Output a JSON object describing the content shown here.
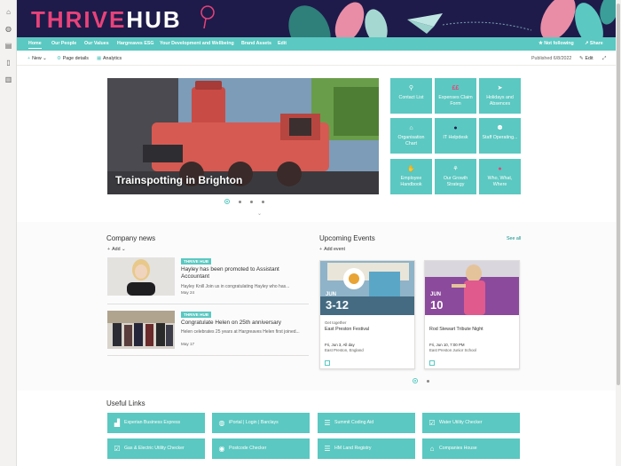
{
  "banner": {
    "logo_thrive": "THRIVE",
    "logo_hub": "HUB"
  },
  "nav": {
    "items": [
      "Home",
      "Our People",
      "Our Values",
      "Hargreaves ESG",
      "Your Development and Wellbeing",
      "Brand Assets",
      "Edit"
    ],
    "follow": "Not following",
    "share": "Share"
  },
  "commands": {
    "new": "New",
    "page_details": "Page details",
    "analytics": "Analytics",
    "published": "Published 6/8/2022",
    "edit": "Edit"
  },
  "hero": {
    "title": "Trainspotting in Brighton"
  },
  "tiles": [
    {
      "label": "Contact List",
      "icon": "search-icon"
    },
    {
      "label": "Expenses Claim Form",
      "icon": "money-icon"
    },
    {
      "label": "Holidays and Absences",
      "icon": "plane-icon"
    },
    {
      "label": "Organisation Chart",
      "icon": "org-chart-icon"
    },
    {
      "label": "IT Helpdesk",
      "icon": "headset-icon"
    },
    {
      "label": "Staff Operating...",
      "icon": "people-icon"
    },
    {
      "label": "Employee Handbook",
      "icon": "hand-icon"
    },
    {
      "label": "Our Growth Strategy",
      "icon": "growth-icon"
    },
    {
      "label": "Who, What, Where",
      "icon": "location-icon"
    }
  ],
  "news": {
    "title": "Company news",
    "add": "Add",
    "items": [
      {
        "tag": "THRIVE HUB",
        "title": "Hayley has been promoted to Assistant Accountant",
        "excerpt": "Hayley Knill Join us in congratulating Hayley who has...",
        "date": "May 24"
      },
      {
        "tag": "THRIVE HUB",
        "title": "Congratulate Helen on 25th anniversary",
        "excerpt": "Helen celebrates 25 years at Hargreaves Helen first joined...",
        "date": "May 17"
      }
    ]
  },
  "events": {
    "title": "Upcoming Events",
    "add": "Add event",
    "see_all": "See all",
    "items": [
      {
        "month": "JUN",
        "day": "3-12",
        "category": "Get together",
        "title": "East Preston Festival",
        "date": "Fri, Jun 3, All day",
        "location": "East Preston, England"
      },
      {
        "month": "JUN",
        "day": "10",
        "category": "",
        "title": "Rod Stewart Tribute Night",
        "date": "Fri, Jun 10, 7:00 PM",
        "location": "East Preston Junior School"
      }
    ]
  },
  "useful_links": {
    "title": "Useful Links",
    "items": [
      {
        "label": "Experian Business Express",
        "icon": "chart-icon"
      },
      {
        "label": "iPortal | Login | Barclays",
        "icon": "globe-icon"
      },
      {
        "label": "Summit Coding Aid",
        "icon": "list-icon"
      },
      {
        "label": "Water Utility Checker",
        "icon": "check-icon"
      },
      {
        "label": "Gas & Electric Utility Checker",
        "icon": "check-icon"
      },
      {
        "label": "Postcode Checker",
        "icon": "target-icon"
      },
      {
        "label": "HM Land Registry",
        "icon": "list-icon"
      },
      {
        "label": "Companies House",
        "icon": "home-icon"
      }
    ]
  }
}
